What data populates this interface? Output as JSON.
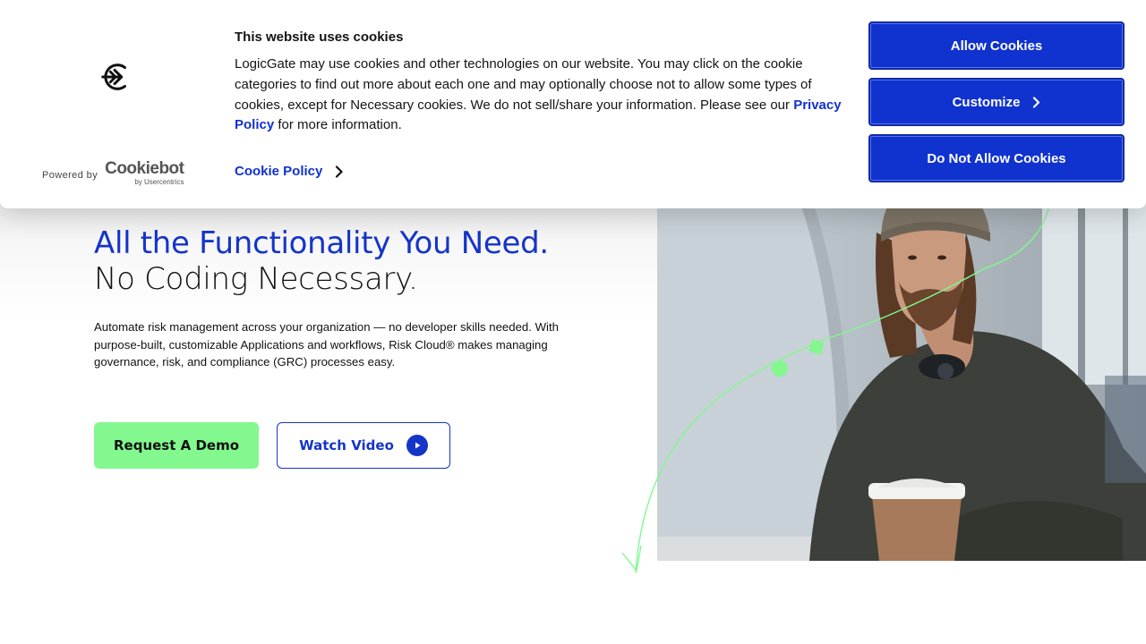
{
  "cookie_banner": {
    "title": "This website uses cookies",
    "body_before": "LogicGate may use cookies and other technologies on our website. You may click on the cookie categories to find out more about each one and may optionally choose not to allow some types of cookies, except for Necessary cookies.  We do not sell/share your information. Please see our ",
    "privacy_link": "Privacy Policy",
    "body_after": " for more information.",
    "cookie_policy_link": "Cookie Policy",
    "powered_by": "Powered by",
    "cookiebot_brand": "Cookiebot",
    "cookiebot_sub": "by Usercentrics",
    "buttons": {
      "allow": "Allow Cookies",
      "customize": "Customize",
      "deny": "Do Not Allow Cookies"
    }
  },
  "hero": {
    "title_line1": "All the Functionality You Need.",
    "title_line2": "No Coding Necessary.",
    "description": "Automate risk management across your organization — no developer skills needed. With purpose-built, customizable Applications and workflows, Risk Cloud® makes managing governance, risk, and compliance (GRC) processes easy.",
    "demo_button": "Request A Demo",
    "video_button": "Watch Video"
  },
  "colors": {
    "brand_blue": "#1535c8",
    "cookie_button_blue": "#1032cf",
    "accent_green": "#82f88f"
  }
}
